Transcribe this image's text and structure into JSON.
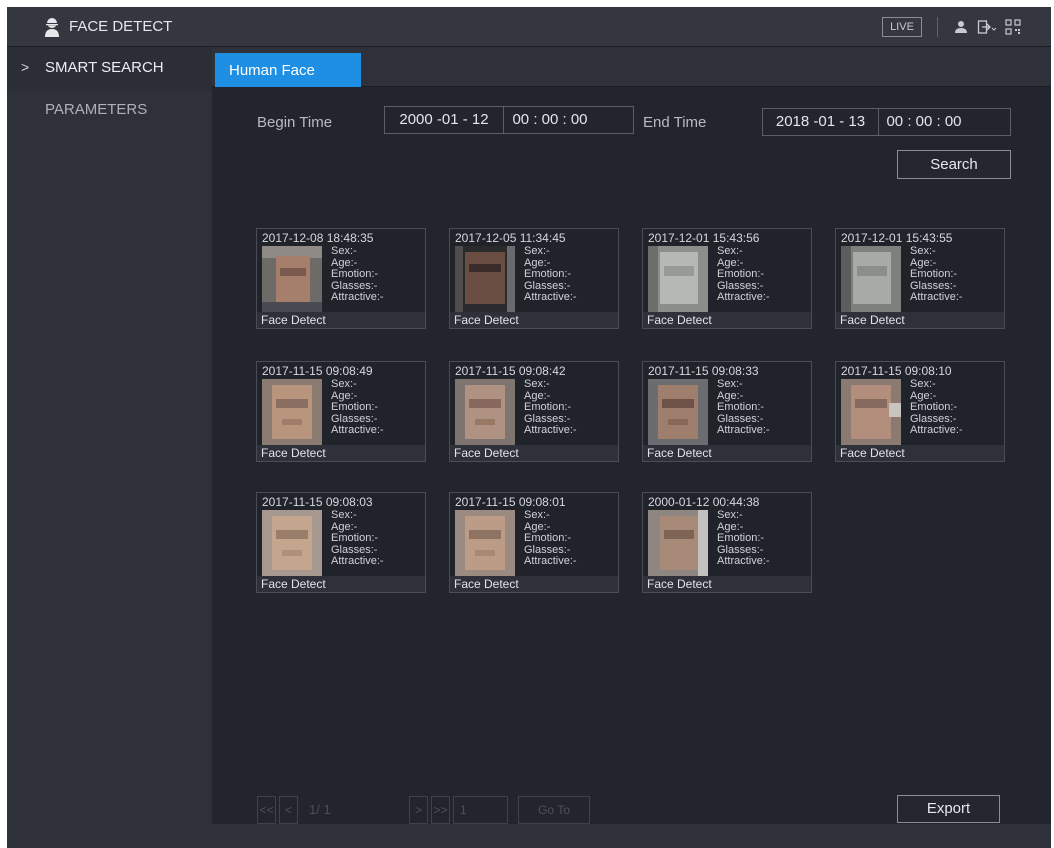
{
  "header": {
    "title": "FACE DETECT",
    "live_label": "LIVE"
  },
  "sidebar": {
    "items": [
      {
        "arrow": ">",
        "label": "SMART SEARCH"
      },
      {
        "label": "PARAMETERS"
      }
    ]
  },
  "tabs": [
    {
      "label": "Human Face"
    }
  ],
  "search": {
    "begin_label": "Begin Time",
    "begin_date": "2000 -01 - 12",
    "begin_time": "00 : 00 : 00",
    "end_label": "End Time",
    "end_date": "2018 -01 - 13",
    "end_time": "00 : 00 : 00",
    "search_label": "Search"
  },
  "results": [
    {
      "time": "2017-12-08 18:48:35",
      "sex": "Sex:-",
      "age": "Age:-",
      "emotion": "Emotion:-",
      "glasses": "Glasses:-",
      "attractive": "Attractive:-",
      "source": "Face Detect"
    },
    {
      "time": "2017-12-05 11:34:45",
      "sex": "Sex:-",
      "age": "Age:-",
      "emotion": "Emotion:-",
      "glasses": "Glasses:-",
      "attractive": "Attractive:-",
      "source": "Face Detect"
    },
    {
      "time": "2017-12-01 15:43:56",
      "sex": "Sex:-",
      "age": "Age:-",
      "emotion": "Emotion:-",
      "glasses": "Glasses:-",
      "attractive": "Attractive:-",
      "source": "Face Detect"
    },
    {
      "time": "2017-12-01 15:43:55",
      "sex": "Sex:-",
      "age": "Age:-",
      "emotion": "Emotion:-",
      "glasses": "Glasses:-",
      "attractive": "Attractive:-",
      "source": "Face Detect"
    },
    {
      "time": "2017-11-15 09:08:49",
      "sex": "Sex:-",
      "age": "Age:-",
      "emotion": "Emotion:-",
      "glasses": "Glasses:-",
      "attractive": "Attractive:-",
      "source": "Face Detect"
    },
    {
      "time": "2017-11-15 09:08:42",
      "sex": "Sex:-",
      "age": "Age:-",
      "emotion": "Emotion:-",
      "glasses": "Glasses:-",
      "attractive": "Attractive:-",
      "source": "Face Detect"
    },
    {
      "time": "2017-11-15 09:08:33",
      "sex": "Sex:-",
      "age": "Age:-",
      "emotion": "Emotion:-",
      "glasses": "Glasses:-",
      "attractive": "Attractive:-",
      "source": "Face Detect"
    },
    {
      "time": "2017-11-15 09:08:10",
      "sex": "Sex:-",
      "age": "Age:-",
      "emotion": "Emotion:-",
      "glasses": "Glasses:-",
      "attractive": "Attractive:-",
      "source": "Face Detect"
    },
    {
      "time": "2017-11-15 09:08:03",
      "sex": "Sex:-",
      "age": "Age:-",
      "emotion": "Emotion:-",
      "glasses": "Glasses:-",
      "attractive": "Attractive:-",
      "source": "Face Detect"
    },
    {
      "time": "2017-11-15 09:08:01",
      "sex": "Sex:-",
      "age": "Age:-",
      "emotion": "Emotion:-",
      "glasses": "Glasses:-",
      "attractive": "Attractive:-",
      "source": "Face Detect"
    },
    {
      "time": "2000-01-12 00:44:38",
      "sex": "Sex:-",
      "age": "Age:-",
      "emotion": "Emotion:-",
      "glasses": "Glasses:-",
      "attractive": "Attractive:-",
      "source": "Face Detect"
    }
  ],
  "pagination": {
    "first": "<<",
    "prev": "<",
    "page_info": "1/ 1",
    "next": ">",
    "last": ">>",
    "page_value": "1",
    "goto_label": "Go To"
  },
  "export_label": "Export",
  "icons": {
    "brand": "face-detect-icon",
    "user": "user-icon",
    "logout": "logout-icon",
    "qr": "qr-code-icon"
  },
  "colors": {
    "accent": "#1e8fe3",
    "background": "#22252d",
    "panel": "#2e3139"
  }
}
